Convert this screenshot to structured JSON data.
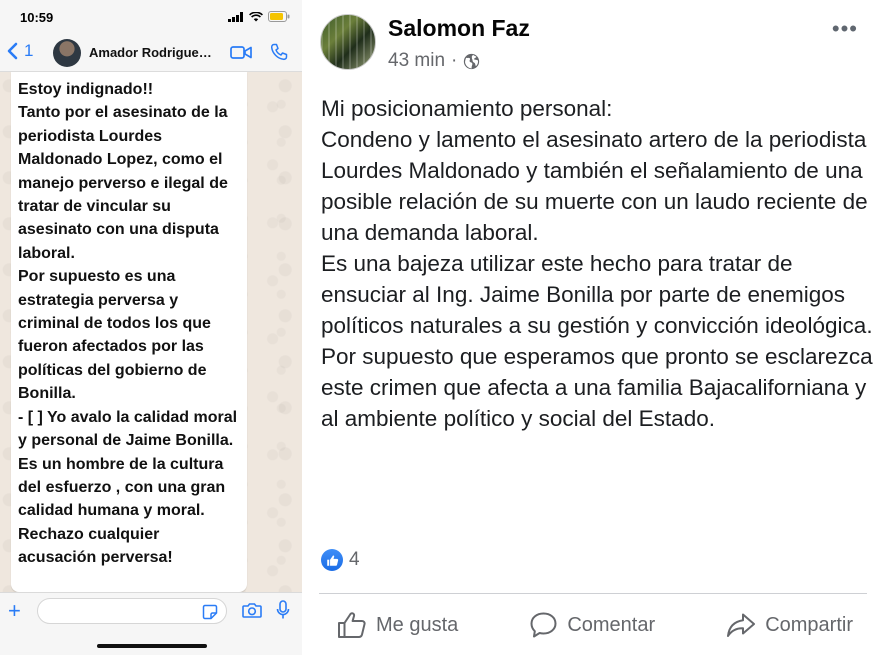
{
  "whatsapp": {
    "status_time": "10:59",
    "back_count": "1",
    "contact_name": "Amador Rodrigue…",
    "message": "Estoy indignado!!\nTanto por el asesinato de la periodista Lourdes Maldonado Lopez, como el manejo perverso e ilegal de tratar de vincular su asesinato con una disputa laboral.\nPor supuesto es una estrategia perversa y criminal de todos los que fueron afectados por las políticas del gobierno de Bonilla.\n- [ ] Yo avalo la calidad moral y personal de Jaime Bonilla. Es un hombre de la  cultura del esfuerzo , con una gran calidad humana y moral.\nRechazo cualquier acusación perversa!",
    "accent_color": "#2a7cf6"
  },
  "facebook": {
    "author": "Salomon Faz",
    "time": "43 min",
    "separator": "·",
    "audience_icon": "globe-icon",
    "more_label": "•••",
    "post_text": "Mi posicionamiento personal:\nCondeno y lamento el asesinato artero de la periodista Lourdes Maldonado y también el señalamiento de una posible relación de su muerte con un laudo reciente de una demanda laboral.\nEs una bajeza utilizar este hecho para tratar de ensuciar al Ing. Jaime Bonilla por parte de enemigos políticos naturales a su gestión y convicción ideológica.\nPor supuesto que esperamos que pronto se esclarezca este crimen que afecta a una familia Bajacaliforniana y al ambiente político y social del Estado.",
    "reaction_count": "4",
    "actions": {
      "like": "Me gusta",
      "comment": "Comentar",
      "share": "Compartir"
    },
    "like_color": "#1a6ce6",
    "muted_color": "#65676b"
  }
}
